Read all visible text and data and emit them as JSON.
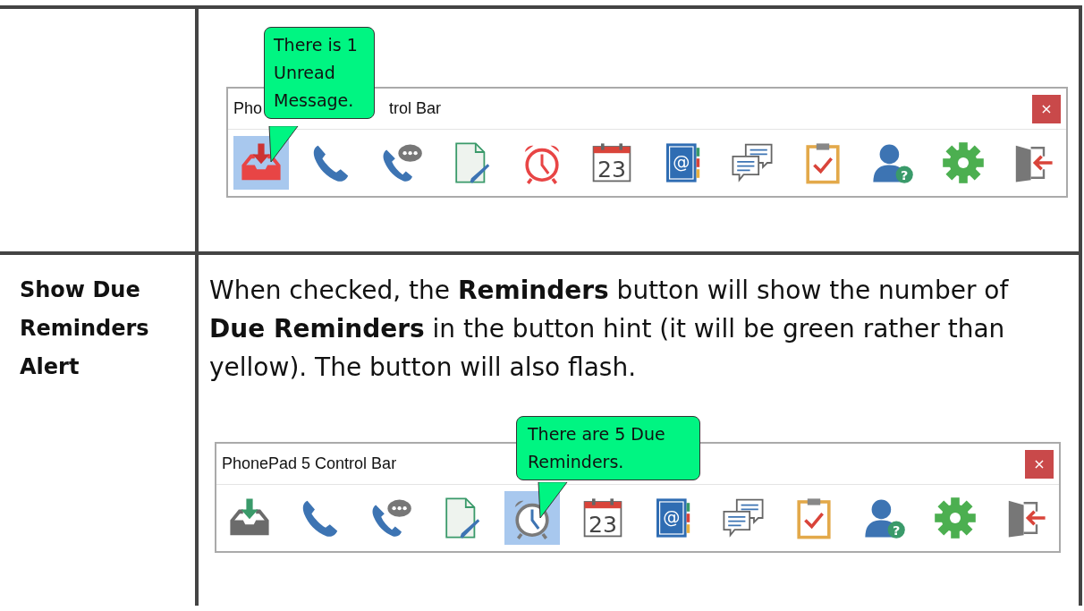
{
  "rows": [
    {
      "term": "",
      "description": "",
      "control_bar": {
        "title_parts": [
          "Pho",
          "trol Bar"
        ],
        "close": "×",
        "tooltip": "There is 1 Unread Message.",
        "buttons": [
          {
            "kind": "inbox",
            "selected": true,
            "color": "#e84545"
          },
          {
            "kind": "phone",
            "selected": false
          },
          {
            "kind": "phone-chat",
            "selected": false
          },
          {
            "kind": "note",
            "selected": false
          },
          {
            "kind": "alarm",
            "selected": false,
            "color": "#e84545"
          },
          {
            "kind": "calendar",
            "selected": false,
            "label": "23"
          },
          {
            "kind": "address-book",
            "selected": false,
            "label": "@"
          },
          {
            "kind": "chat",
            "selected": false
          },
          {
            "kind": "clipboard",
            "selected": false
          },
          {
            "kind": "user-help",
            "selected": false,
            "label": "?"
          },
          {
            "kind": "gear",
            "selected": false
          },
          {
            "kind": "exit",
            "selected": false
          }
        ]
      }
    },
    {
      "term": "Show Due Reminders Alert",
      "description": "When checked, the **Reminders** button will show the number of **Due Reminders** in the button hint (it will be green rather than yellow).  The button will also flash.",
      "control_bar": {
        "title_parts": [
          "PhonePad 5 Control Bar"
        ],
        "close": "×",
        "tooltip": "There are 5 Due Reminders.",
        "buttons": [
          {
            "kind": "inbox",
            "selected": false,
            "color": "#6b6b6b"
          },
          {
            "kind": "phone",
            "selected": false
          },
          {
            "kind": "phone-chat",
            "selected": false
          },
          {
            "kind": "note",
            "selected": false
          },
          {
            "kind": "alarm",
            "selected": true,
            "color": "#7a7a7a"
          },
          {
            "kind": "calendar",
            "selected": false,
            "label": "23"
          },
          {
            "kind": "address-book",
            "selected": false,
            "label": "@"
          },
          {
            "kind": "chat",
            "selected": false
          },
          {
            "kind": "clipboard",
            "selected": false
          },
          {
            "kind": "user-help",
            "selected": false,
            "label": "?"
          },
          {
            "kind": "gear",
            "selected": false
          },
          {
            "kind": "exit",
            "selected": false
          }
        ]
      }
    }
  ]
}
